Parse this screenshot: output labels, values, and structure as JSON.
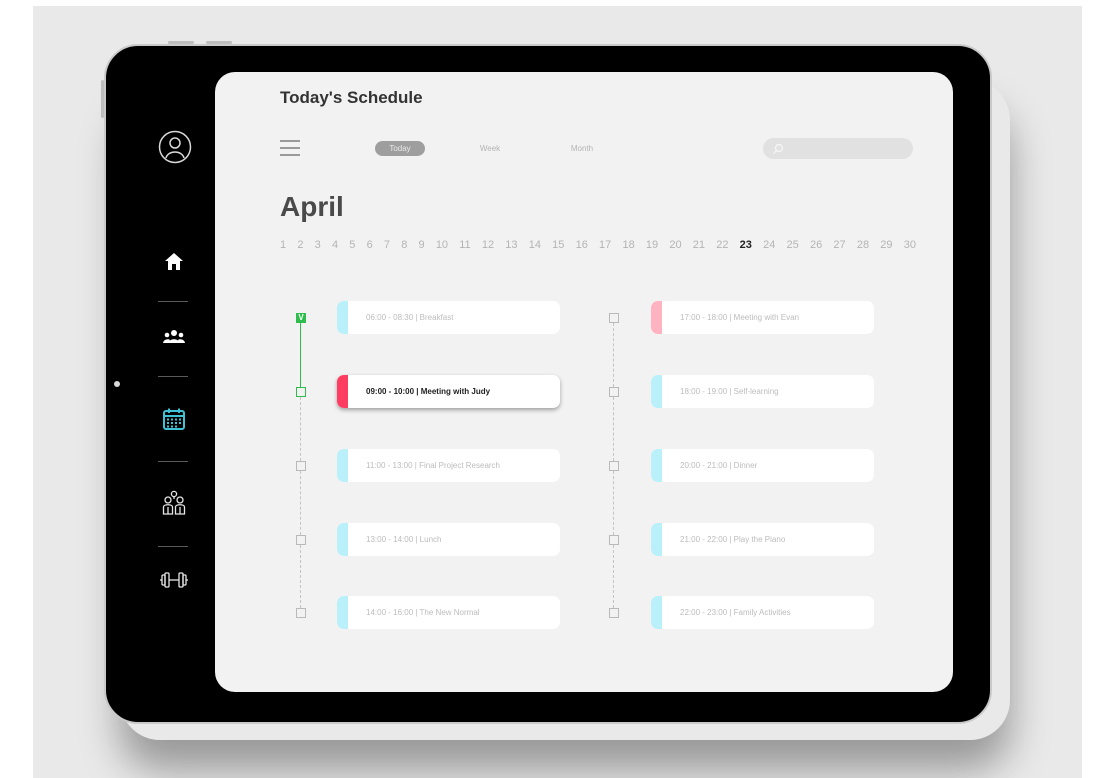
{
  "page": {
    "title": "Today's Schedule",
    "month": "April"
  },
  "colors": {
    "accent": "#3fc1d6",
    "done": "#2ebd4c",
    "event_blue": "#b9f0fa",
    "event_pink": "#ffb3c1",
    "event_red": "#ff3d61"
  },
  "sidebar": {
    "items": [
      {
        "name": "profile",
        "icon": "user-circle-icon"
      },
      {
        "name": "home",
        "icon": "home-icon"
      },
      {
        "name": "groups",
        "icon": "group-icon"
      },
      {
        "name": "calendar",
        "icon": "calendar-icon",
        "active": true
      },
      {
        "name": "family",
        "icon": "family-icon"
      },
      {
        "name": "fitness",
        "icon": "dumbbell-icon"
      }
    ]
  },
  "view_tabs": {
    "today": "Today",
    "week": "Week",
    "month": "Month",
    "selected": "Today"
  },
  "search": {
    "placeholder": ""
  },
  "days": [
    "1",
    "2",
    "3",
    "4",
    "5",
    "6",
    "7",
    "8",
    "9",
    "10",
    "11",
    "12",
    "13",
    "14",
    "15",
    "16",
    "17",
    "18",
    "19",
    "20",
    "21",
    "22",
    "23",
    "24",
    "25",
    "26",
    "27",
    "28",
    "29",
    "30"
  ],
  "selected_day": "23",
  "schedule": {
    "left": [
      {
        "label": "06:00 - 08:30 | Breakfast",
        "color": "#b9f0fa",
        "status": "done",
        "check_mark": "V"
      },
      {
        "label": "09:00 - 10:00 | Meeting with Judy",
        "color": "#ff3d61",
        "status": "current",
        "check_mark": ""
      },
      {
        "label": "11:00 - 13:00 | Final Project Research",
        "color": "#b9f0fa",
        "status": "todo",
        "check_mark": ""
      },
      {
        "label": "13:00 - 14:00 | Lunch",
        "color": "#b9f0fa",
        "status": "todo",
        "check_mark": ""
      },
      {
        "label": "14:00 - 16:00 | The New Normal",
        "color": "#b9f0fa",
        "status": "todo",
        "check_mark": ""
      }
    ],
    "right": [
      {
        "label": "17:00 - 18:00 | Meeting with Evan",
        "color": "#ffb3c1",
        "status": "todo",
        "check_mark": ""
      },
      {
        "label": "18:00 - 19:00 | Self-learning",
        "color": "#b9f0fa",
        "status": "todo",
        "check_mark": ""
      },
      {
        "label": "20:00 - 21:00 | Dinner",
        "color": "#b9f0fa",
        "status": "todo",
        "check_mark": ""
      },
      {
        "label": "21:00 - 22:00 | Play the Piano",
        "color": "#b9f0fa",
        "status": "todo",
        "check_mark": ""
      },
      {
        "label": "22:00 - 23:00 | Family Activities",
        "color": "#b9f0fa",
        "status": "todo",
        "check_mark": ""
      }
    ]
  }
}
